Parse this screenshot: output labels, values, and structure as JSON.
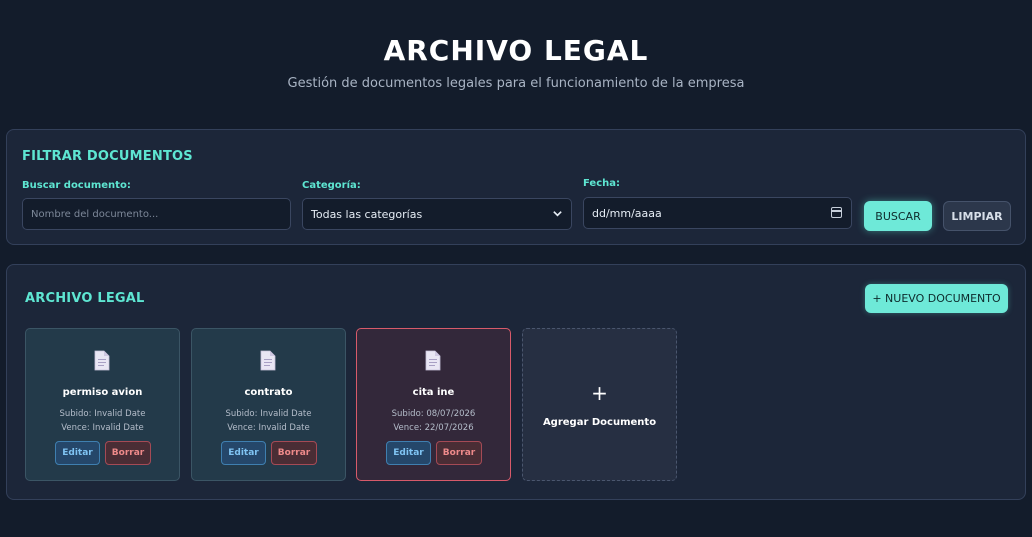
{
  "header": {
    "title": "ARCHIVO LEGAL",
    "subtitle": "Gestión de documentos legales para el funcionamiento de la empresa"
  },
  "filter": {
    "title": "FILTRAR DOCUMENTOS",
    "search_label": "Buscar documento:",
    "search_placeholder": "Nombre del documento...",
    "search_value": "",
    "category_label": "Categoría:",
    "category_value": "Todas las categorías",
    "date_label": "Fecha:",
    "date_value": "dd/mm/aaaa",
    "search_button": "BUSCAR",
    "clear_button": "LIMPIAR"
  },
  "archive": {
    "title": "ARCHIVO LEGAL",
    "new_button": "+ NUEVO DOCUMENTO",
    "documents": [
      {
        "name": "permiso avion",
        "uploaded": "Subido: Invalid Date",
        "expires": "Vence: Invalid Date",
        "edit": "Editar",
        "delete": "Borrar",
        "status": "normal"
      },
      {
        "name": "contrato",
        "uploaded": "Subido: Invalid Date",
        "expires": "Vence: Invalid Date",
        "edit": "Editar",
        "delete": "Borrar",
        "status": "normal"
      },
      {
        "name": "cita ine",
        "uploaded": "Subido: 08/07/2026",
        "expires": "Vence: 22/07/2026",
        "edit": "Editar",
        "delete": "Borrar",
        "status": "alert"
      }
    ],
    "add_plus": "+",
    "add_label": "Agregar Documento"
  },
  "icons": {
    "document": "document-icon",
    "dropdown": "chevron-down-icon",
    "calendar": "calendar-icon"
  },
  "colors": {
    "background": "#131c2b",
    "panel": "#1c2639",
    "accent": "#5ee6d2",
    "alert_border": "#d75a6a",
    "edit": "#7fc3f2",
    "delete": "#ee8a8a"
  }
}
